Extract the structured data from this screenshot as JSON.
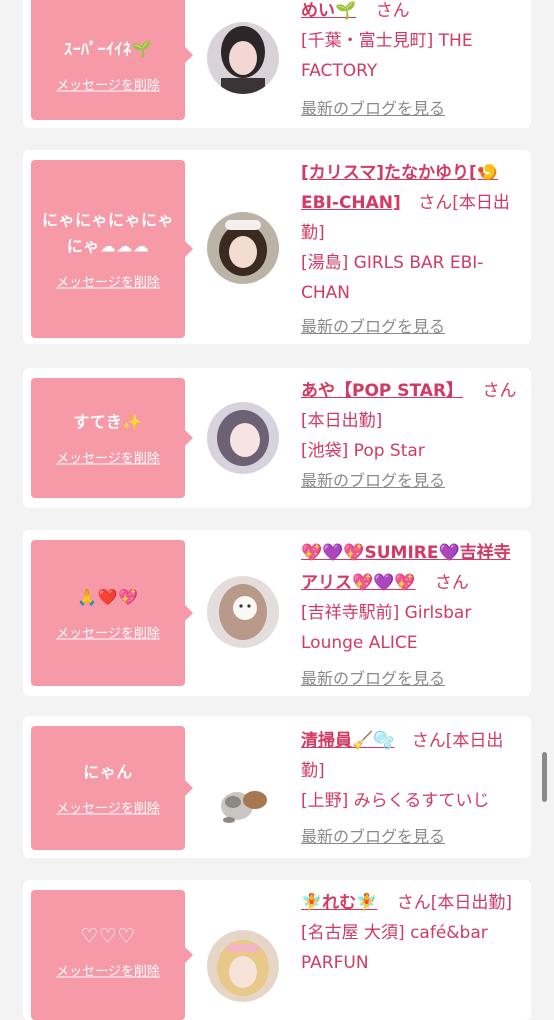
{
  "cards": [
    {
      "message": "ｽｰﾊﾟｰｲｲﾈ🌱",
      "delete_label": "メッセージを削除",
      "name": "めい🌱",
      "san": "さん",
      "shop": "[千葉・富士見町] THE FACTORY",
      "blog_label": "最新のブログを見る"
    },
    {
      "message": "にゃにゃにゃにゃにゃ☁☁☁",
      "delete_label": "メッセージを削除",
      "name": "[カリスマ]たなかゆり[🍤EBI-CHAN]",
      "san": "さん[本日出勤]",
      "shop": "[湯島] GIRLS BAR EBI-CHAN",
      "blog_label": "最新のブログを見る"
    },
    {
      "message": "すてき✨",
      "delete_label": "メッセージを削除",
      "name": "あや【POP STAR】",
      "san": "さん[本日出勤]",
      "shop": "[池袋] Pop Star",
      "blog_label": "最新のブログを見る"
    },
    {
      "message": "🙏❤️💖",
      "delete_label": "メッセージを削除",
      "name": "💖💜💖SUMIRE💜吉祥寺アリス💖💜💖",
      "san": "さん",
      "shop": "[吉祥寺駅前] Girlsbar Lounge ALICE",
      "blog_label": "最新のブログを見る"
    },
    {
      "message": "にゃん",
      "delete_label": "メッセージを削除",
      "name": "清掃員🧹🫧",
      "san": "さん[本日出勤]",
      "shop": "[上野] みらくるすていじ",
      "blog_label": "最新のブログを見る"
    },
    {
      "message": "♡♡♡",
      "delete_label": "メッセージを削除",
      "name": "🧚れむ🧚",
      "san": "さん[本日出勤]",
      "shop": "[名古屋 大須] café&bar PARFUN",
      "blog_label": ""
    }
  ],
  "colors": {
    "bubble": "#f79aa8",
    "name": "#d23a63",
    "link_gray": "#8a8a8a",
    "background": "#f4f3f3"
  }
}
